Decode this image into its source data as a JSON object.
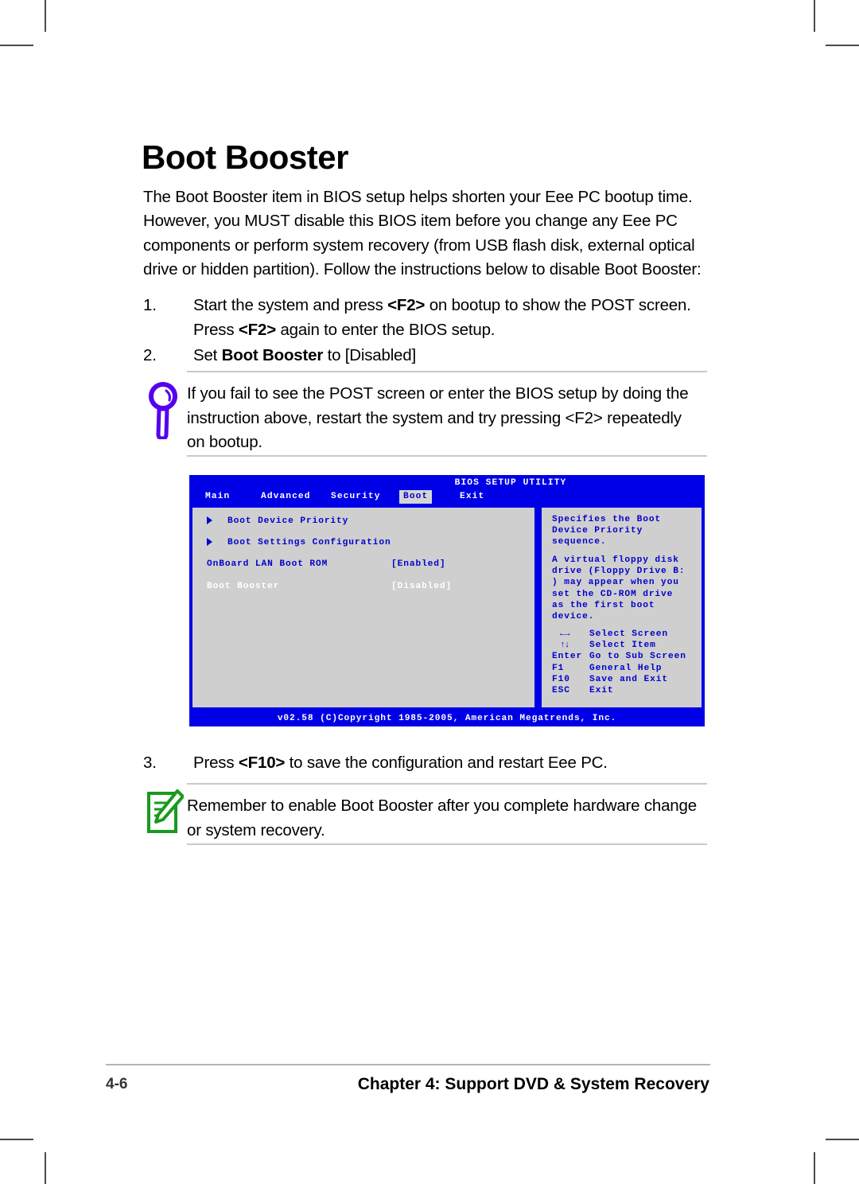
{
  "page": {
    "heading": "Boot Booster",
    "intro": "The Boot Booster item in BIOS setup helps shorten your Eee PC bootup time. However, you MUST disable this BIOS item before you change any Eee PC components or perform system recovery (from USB flash disk, external optical drive or hidden partition). Follow the instructions below to disable Boot Booster:"
  },
  "steps": [
    {
      "number": "1.",
      "text_1": "Start the system and press ",
      "key_1": "<F2>",
      "text_2": " on bootup to show the POST screen. Press ",
      "key_2": "<F2>",
      "text_3": " again to enter the BIOS setup."
    },
    {
      "number": "2.",
      "text_1": "Set ",
      "bold_1": "Boot Booster",
      "text_2": " to [Disabled]"
    },
    {
      "number": "3.",
      "text_1": "Press ",
      "key_1": "<F10>",
      "text_2": " to save the configuration and restart Eee PC."
    }
  ],
  "tip": {
    "icon": "magnifier-icon",
    "icon_color": "#5500EE",
    "text": "If you fail to see the POST screen or enter the BIOS setup by doing the instruction above, restart the system and try pressing <F2> repeatedly on bootup."
  },
  "note": {
    "icon": "note-pencil-icon",
    "icon_color": "#189A1E",
    "text": "Remember to enable Boot Booster after you complete hardware change or system recovery."
  },
  "bios": {
    "title": "BIOS SETUP UTILITY",
    "accent_blue": "#0000E6",
    "panel_gray": "#CFCFCF",
    "text_blue": "#0000CC",
    "menu": [
      {
        "label": "Main",
        "active": false
      },
      {
        "label": "Advanced",
        "active": false
      },
      {
        "label": "Security",
        "active": false
      },
      {
        "label": "Boot",
        "active": true
      },
      {
        "label": "Exit",
        "active": false
      }
    ],
    "options": [
      {
        "label": "Boot Device Priority",
        "value": "",
        "submenu": true,
        "selected": false
      },
      {
        "label": "Boot Settings Configuration",
        "value": "",
        "submenu": true,
        "selected": false
      },
      {
        "label": "OnBoard LAN Boot ROM",
        "value": "[Enabled]",
        "submenu": false,
        "selected": false
      },
      {
        "label": "Boot Booster",
        "value": "[Disabled]",
        "submenu": false,
        "selected": true
      }
    ],
    "help": {
      "paragraph_1": "Specifies the Boot\nDevice Priority\nsequence.",
      "paragraph_2": "A virtual floppy disk\ndrive (Floppy Drive B:\n) may appear when you\nset the CD-ROM drive\nas the first boot\ndevice."
    },
    "keys": [
      {
        "key": "←→",
        "desc": "Select Screen",
        "arrows": true
      },
      {
        "key": "↑↓",
        "desc": "Select Item",
        "arrows": true
      },
      {
        "key": "Enter",
        "desc": "Go to Sub Screen",
        "arrows": false
      },
      {
        "key": "F1",
        "desc": "General Help",
        "arrows": false
      },
      {
        "key": "F10",
        "desc": "Save and Exit",
        "arrows": false
      },
      {
        "key": "ESC",
        "desc": "Exit",
        "arrows": false
      }
    ],
    "footer": "v02.58 (C)Copyright 1985-2005, American Megatrends, Inc."
  },
  "footer": {
    "page_number": "4-6",
    "chapter": "Chapter 4: Support DVD & System Recovery"
  }
}
